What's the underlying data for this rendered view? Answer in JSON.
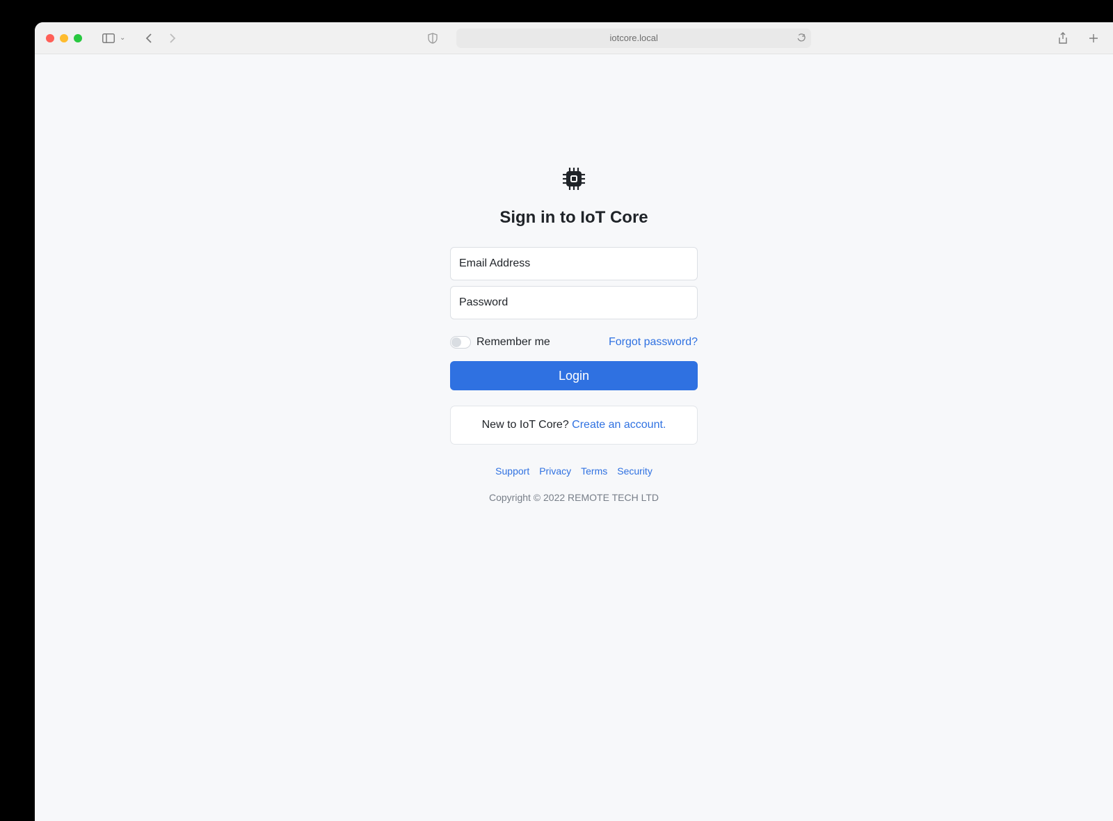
{
  "browser": {
    "address": "iotcore.local"
  },
  "page": {
    "heading": "Sign in to IoT Core",
    "email_placeholder": "Email Address",
    "password_placeholder": "Password",
    "remember_label": "Remember me",
    "forgot_label": "Forgot password?",
    "login_label": "Login",
    "signup_prompt": "New to IoT Core? ",
    "signup_link": "Create an account.",
    "footer": {
      "support": "Support",
      "privacy": "Privacy",
      "terms": "Terms",
      "security": "Security"
    },
    "copyright": "Copyright © 2022 REMOTE TECH LTD"
  }
}
